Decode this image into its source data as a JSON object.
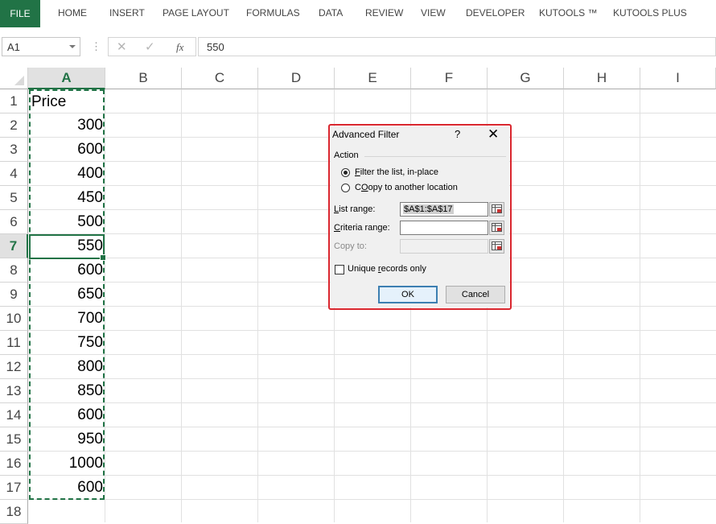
{
  "ribbon": {
    "file_label": "FILE",
    "tabs": [
      "HOME",
      "INSERT",
      "PAGE LAYOUT",
      "FORMULAS",
      "DATA",
      "REVIEW",
      "VIEW",
      "DEVELOPER",
      "KUTOOLS ™",
      "KUTOOLS PLUS"
    ]
  },
  "formula_bar": {
    "name_box": "A1",
    "fx": "fx",
    "value": "550"
  },
  "columns": [
    "A",
    "B",
    "C",
    "D",
    "E",
    "F",
    "G",
    "H",
    "I"
  ],
  "selected_column": "A",
  "rows": [
    "1",
    "2",
    "3",
    "4",
    "5",
    "6",
    "7",
    "8",
    "9",
    "10",
    "11",
    "12",
    "13",
    "14",
    "15",
    "16",
    "17",
    "18"
  ],
  "selected_row": "7",
  "column_a": {
    "header": "Price",
    "values": [
      "300",
      "600",
      "400",
      "450",
      "500",
      "550",
      "600",
      "650",
      "700",
      "750",
      "800",
      "850",
      "600",
      "950",
      "1000",
      "600"
    ]
  },
  "dialog": {
    "title": "Advanced Filter",
    "help": "?",
    "close": "✕",
    "action_label": "Action",
    "radio1_pre": "",
    "radio1_key": "F",
    "radio1_post": "ilter the list, in-place",
    "radio2_pre": "",
    "radio2_key": "O",
    "radio2_post": "opy to another location",
    "list_range_key": "L",
    "list_range_post": "ist range:",
    "list_range_value": "$A$1:$A$17",
    "criteria_range_key": "C",
    "criteria_range_post": "riteria range:",
    "criteria_range_value": "",
    "copy_to_label": "Copy to:",
    "unique_pre": "Unique ",
    "unique_key": "r",
    "unique_post": "ecords only",
    "ok_label": "OK",
    "cancel_label": "Cancel"
  }
}
